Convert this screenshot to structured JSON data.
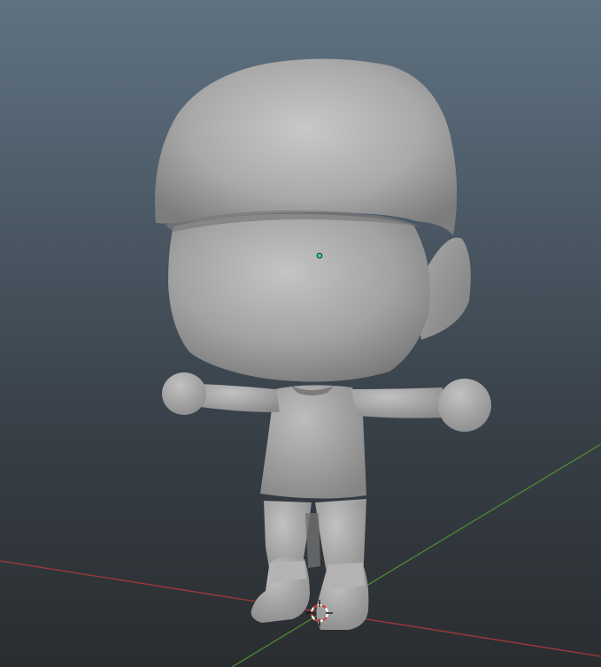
{
  "viewport": {
    "background_top_color": "#5f7282",
    "background_bottom_color": "#2a2d30"
  },
  "grid": {
    "x_axis_color": "#a33a3a",
    "y_axis_color": "#4f8a32"
  },
  "model": {
    "base_color": "#9a9a9a"
  },
  "object_origin": {
    "color": "#3fd0a0"
  },
  "cursor_3d": {
    "ring_color_a": "#ffffff",
    "ring_color_b": "#d23b3b"
  }
}
